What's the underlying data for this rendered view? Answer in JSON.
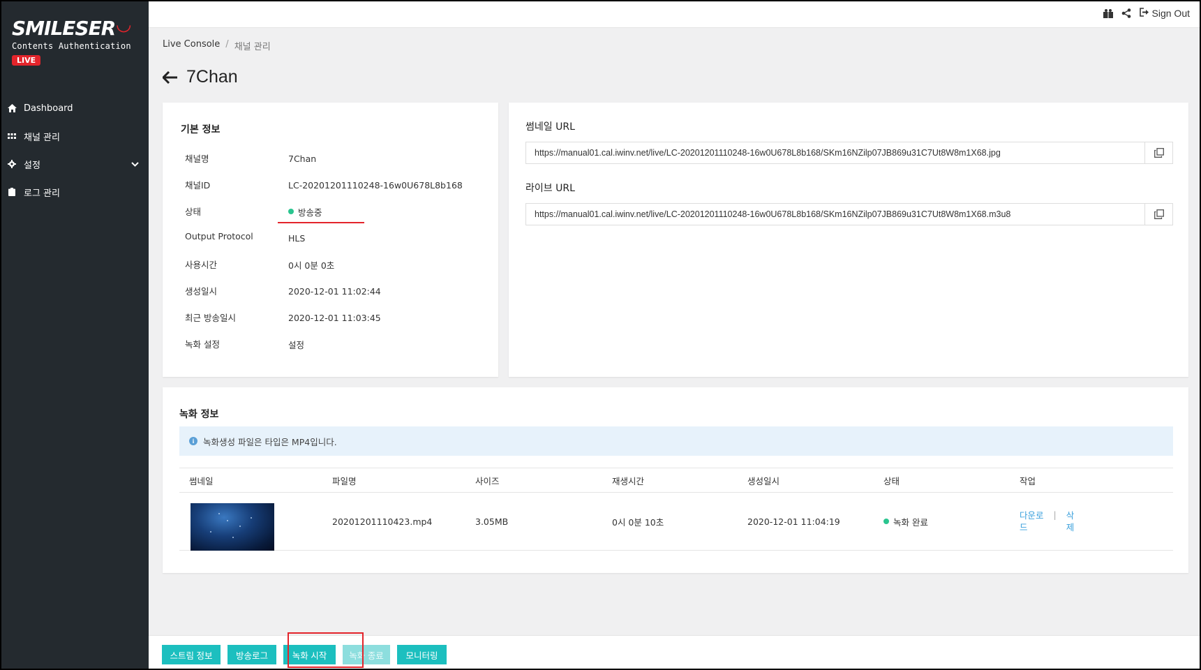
{
  "app": {
    "logo_text": "SMILESER",
    "logo_sub": "Contents Authentication",
    "live_badge": "LIVE",
    "brand_red": "#e3242b",
    "accent_teal": "#1cbfbf"
  },
  "sidebar": {
    "items": [
      {
        "label": "Dashboard",
        "icon": "home-icon"
      },
      {
        "label": "채널 관리",
        "icon": "grid-icon"
      },
      {
        "label": "설정",
        "icon": "gear-icon"
      },
      {
        "label": "로그 관리",
        "icon": "clipboard-icon"
      }
    ]
  },
  "topbar": {
    "signout_label": "Sign Out"
  },
  "breadcrumb": {
    "root": "Live Console",
    "separator": "/",
    "current": "채널 관리"
  },
  "page": {
    "title": "7Chan"
  },
  "basic_info": {
    "title": "기본 정보",
    "rows": [
      {
        "label": "채널명",
        "value": "7Chan"
      },
      {
        "label": "채널ID",
        "value": "LC-20201201110248-16w0U678L8b168"
      },
      {
        "label": "상태",
        "value": "방송중"
      },
      {
        "label": "Output Protocol",
        "value": "HLS"
      },
      {
        "label": "사용시간",
        "value": "0시 0분 0초"
      },
      {
        "label": "생성일시",
        "value": "2020-12-01 11:02:44"
      },
      {
        "label": "최근 방송일시",
        "value": "2020-12-01 11:03:45"
      },
      {
        "label": "녹화 설정",
        "value": "설정"
      }
    ]
  },
  "urls": {
    "thumbnail_label": "썸네일 URL",
    "thumbnail_url": "https://manual01.cal.iwinv.net/live/LC-20201201110248-16w0U678L8b168/SKm16NZilp07JB869u31C7Ut8W8m1X68.jpg",
    "live_label": "라이브 URL",
    "live_url": "https://manual01.cal.iwinv.net/live/LC-20201201110248-16w0U678L8b168/SKm16NZilp07JB869u31C7Ut8W8m1X68.m3u8"
  },
  "recording": {
    "title": "녹화 정보",
    "notice": "녹화생성 파일은 타입은 MP4입니다.",
    "columns": [
      "썸네일",
      "파일명",
      "사이즈",
      "재생시간",
      "생성일시",
      "상태",
      "작업"
    ],
    "rows": [
      {
        "filename": "20201201110423.mp4",
        "size": "3.05MB",
        "duration": "0시 0분 10초",
        "created": "2020-12-01 11:04:19",
        "status": "녹화 완료",
        "download_line1": "다운로",
        "download_line2": "드",
        "separator": "|",
        "delete_line1": "삭",
        "delete_line2": "제"
      }
    ]
  },
  "bottom_buttons": {
    "stream_info": "스트림 정보",
    "broadcast_log": "방송로그",
    "record_start": "녹화 시작",
    "record_stop": "녹화 종료",
    "monitoring": "모니터링"
  }
}
